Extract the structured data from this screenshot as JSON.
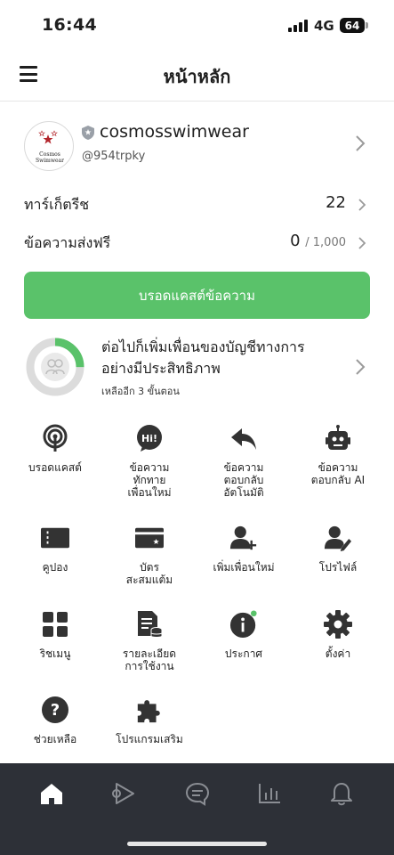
{
  "status_bar": {
    "time": "16:44",
    "network": "4G",
    "battery": "64"
  },
  "header": {
    "title": "หน้าหลัก"
  },
  "account": {
    "avatar_text": "Cosmos Swimwear",
    "name": "cosmosswimwear",
    "id": "@954trpky"
  },
  "stats": {
    "target_label": "ทาร์เก็ตรีช",
    "target_value": "22",
    "free_messages_label": "ข้อความส่งฟรี",
    "free_messages_value": "0",
    "free_messages_quota": "/ 1,000"
  },
  "broadcast_button": {
    "label": "บรอดแคสต์ข้อความ"
  },
  "progress_card": {
    "title": "ต่อไปก็เพิ่มเพื่อนของบัญชีทางการอย่างมีประสิทธิภาพ",
    "subtitle": "เหลืออีก 3 ขั้นตอน",
    "progress": 0.25
  },
  "features": [
    {
      "label": "บรอดแคสต์",
      "icon": "broadcast-icon"
    },
    {
      "label": "ข้อความ\nทักทาย\nเพื่อนใหม่",
      "icon": "hi-greeting-icon"
    },
    {
      "label": "ข้อความ\nตอบกลับ\nอัตโนมัติ",
      "icon": "reply-icon"
    },
    {
      "label": "ข้อความ\nตอบกลับ AI",
      "icon": "robot-icon"
    },
    {
      "label": "คูปอง",
      "icon": "coupon-icon"
    },
    {
      "label": "บัตร\nสะสมแต้ม",
      "icon": "reward-card-icon"
    },
    {
      "label": "เพิ่มเพื่อนใหม่",
      "icon": "add-friend-icon"
    },
    {
      "label": "โปรไฟล์",
      "icon": "profile-edit-icon"
    },
    {
      "label": "ริชเมนู",
      "icon": "rich-menu-icon"
    },
    {
      "label": "รายละเอียด\nการใช้งาน",
      "icon": "usage-details-icon"
    },
    {
      "label": "ประกาศ",
      "icon": "info-icon"
    },
    {
      "label": "ตั้งค่า",
      "icon": "gear-icon"
    },
    {
      "label": "ช่วยเหลือ",
      "icon": "help-icon"
    },
    {
      "label": "โปรแกรมเสริม",
      "icon": "puzzle-icon"
    }
  ],
  "bottom_nav": [
    "home-icon",
    "voom-icon",
    "chat-icon",
    "insights-icon",
    "bell-icon"
  ],
  "colors": {
    "accent": "#5ac26a",
    "nav_bg": "#2d3037",
    "notice_dot": "#5ac26a"
  }
}
